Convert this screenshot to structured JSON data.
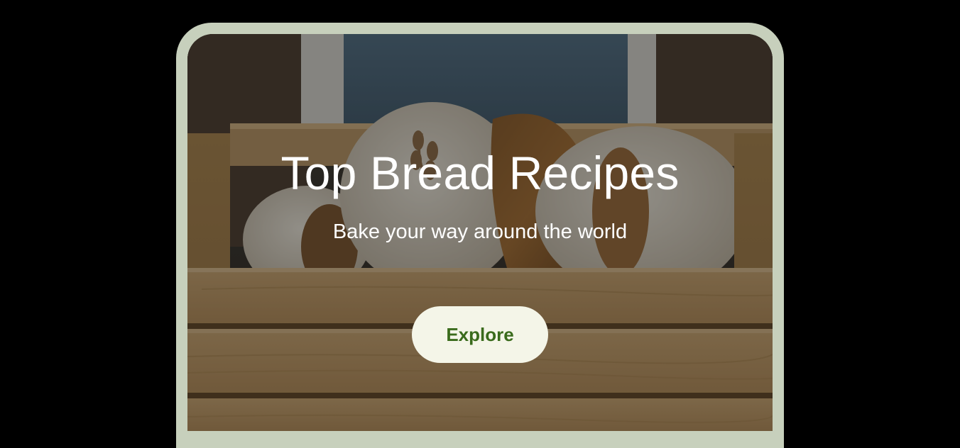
{
  "hero": {
    "title": "Top Bread Recipes",
    "subtitle": "Bake your way around the world",
    "cta_label": "Explore",
    "image_subject": "sourdough loaves in a wooden crate"
  },
  "colors": {
    "frame": "#c7d0bc",
    "button_bg": "#f4f5e8",
    "button_text": "#3a6b1c",
    "title_text": "#ffffff"
  }
}
